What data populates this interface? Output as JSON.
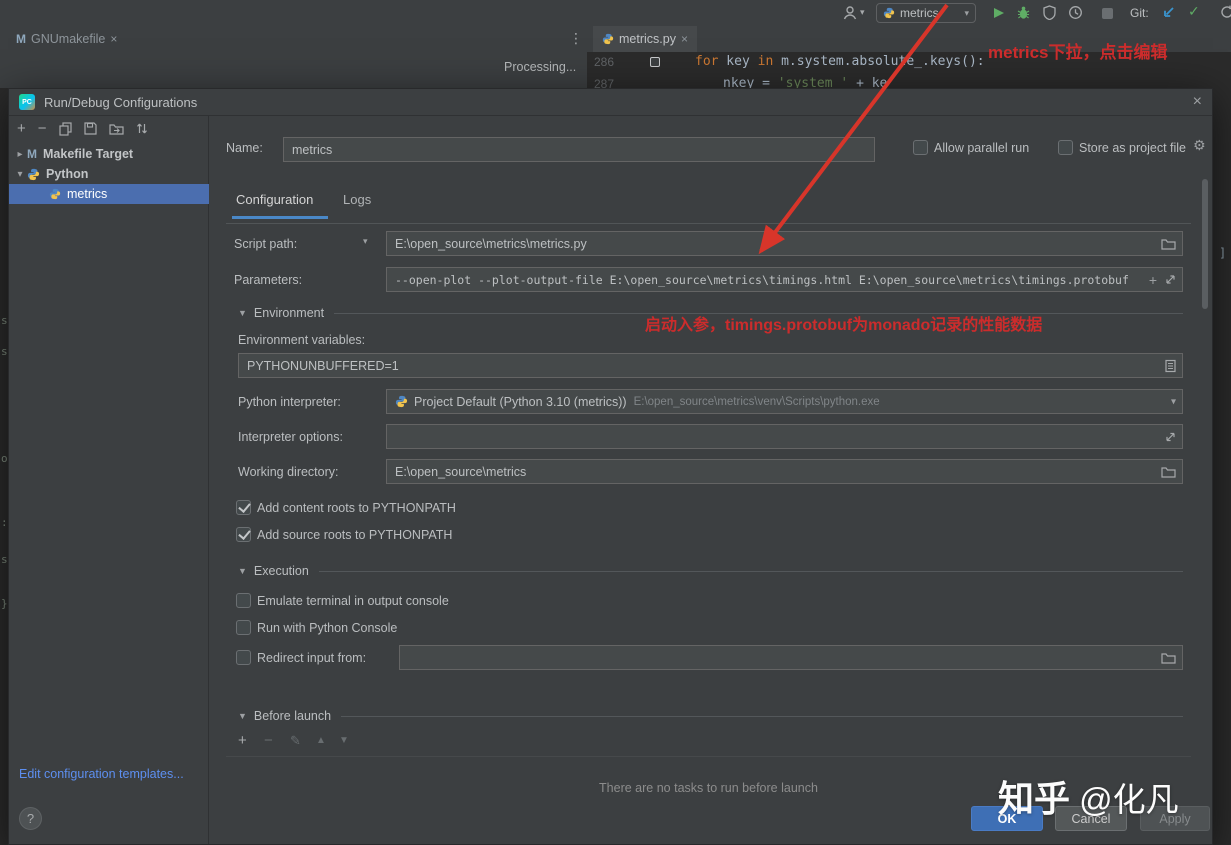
{
  "glyphs": {
    "close": "×",
    "kebab": "⋮",
    "caret_down": "▾",
    "chev_right": "▸",
    "chev_down": "▾",
    "section_tri": "▼",
    "plus": "+",
    "minus": "−",
    "pencil": "✎",
    "up": "▲",
    "down": "▼",
    "check": "✓",
    "gear": "⚙",
    "help": "?",
    "bracket": "]",
    "makefile": "M"
  },
  "chrome": {
    "file_tab": "GNUmakefile",
    "editor_tab": "metrics.py",
    "processing": "Processing...",
    "run_config": "metrics",
    "git_label": "Git:",
    "code": {
      "line1_no": "286",
      "line1_kw1": "for",
      "line1_mid": " key ",
      "line1_kw2": "in",
      "line1_rest": " m.system.absolute_.keys():",
      "line2_no": "287",
      "line2_pre": "nkey = ",
      "line2_str": "'system '",
      "line2_post": " + ke"
    }
  },
  "annotations": {
    "top": "metrics下拉，点击编辑",
    "mid": "启动入参，timings.protobuf为monado记录的性能数据"
  },
  "watermark": {
    "brand": "知乎",
    "user": " @化凡"
  },
  "edge_glyphs": [
    "s",
    "s",
    "o",
    ":",
    "s",
    "}"
  ],
  "dialog": {
    "title": "Run/Debug Configurations",
    "tree": {
      "makefile": "Makefile Target",
      "python": "Python",
      "metrics": "metrics"
    },
    "edit_templates": "Edit configuration templates...",
    "name_label": "Name:",
    "name_value": "metrics",
    "allow_parallel": "Allow parallel run",
    "store_project": "Store as project file",
    "tab_configuration": "Configuration",
    "tab_logs": "Logs",
    "script_path_label": "Script path:",
    "script_path_value": "E:\\open_source\\metrics\\metrics.py",
    "parameters_label": "Parameters:",
    "parameters_value": "--open-plot --plot-output-file E:\\open_source\\metrics\\timings.html E:\\open_source\\metrics\\timings.protobuf",
    "section_environment": "Environment",
    "env_vars_label": "Environment variables:",
    "env_vars_value": "PYTHONUNBUFFERED=1",
    "interpreter_label": "Python interpreter:",
    "interpreter_name": "Project Default (Python 3.10 (metrics))",
    "interpreter_path": "E:\\open_source\\metrics\\venv\\Scripts\\python.exe",
    "interp_opts_label": "Interpreter options:",
    "workdir_label": "Working directory:",
    "workdir_value": "E:\\open_source\\metrics",
    "cb_content_roots": "Add content roots to PYTHONPATH",
    "cb_source_roots": "Add source roots to PYTHONPATH",
    "section_execution": "Execution",
    "cb_emulate_terminal": "Emulate terminal in output console",
    "cb_run_console": "Run with Python Console",
    "cb_redirect_input": "Redirect input from:",
    "section_before_launch": "Before launch",
    "no_tasks": "There are no tasks to run before launch",
    "ok": "OK",
    "cancel": "Cancel",
    "apply": "Apply"
  }
}
